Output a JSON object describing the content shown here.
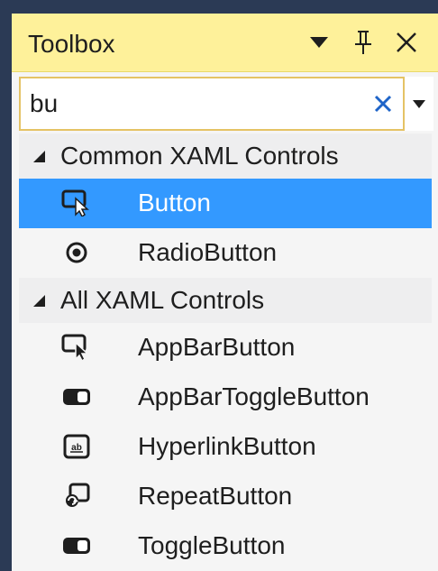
{
  "panel": {
    "title": "Toolbox",
    "buttons": {
      "dropdown_icon": "triangle-down-icon",
      "pin_icon": "pin-icon",
      "close_icon": "close-icon"
    }
  },
  "search": {
    "value": "bu",
    "clear_icon": "clear-x-icon",
    "dropdown_icon": "dropdown-arrow-icon"
  },
  "groups": [
    {
      "label": "Common XAML Controls",
      "expanded": true,
      "items": [
        {
          "label": "Button",
          "icon": "button-control-icon",
          "selected": true
        },
        {
          "label": "RadioButton",
          "icon": "radio-button-icon",
          "selected": false
        }
      ]
    },
    {
      "label": "All XAML Controls",
      "expanded": true,
      "items": [
        {
          "label": "AppBarButton",
          "icon": "button-control-icon",
          "selected": false
        },
        {
          "label": "AppBarToggleButton",
          "icon": "toggle-button-icon",
          "selected": false
        },
        {
          "label": "HyperlinkButton",
          "icon": "hyperlink-button-icon",
          "selected": false
        },
        {
          "label": "RepeatButton",
          "icon": "repeat-button-icon",
          "selected": false
        },
        {
          "label": "ToggleButton",
          "icon": "toggle-button-icon",
          "selected": false
        }
      ]
    }
  ],
  "colors": {
    "title_bar": "#fef19a",
    "selection": "#3399ff",
    "clear_x": "#1e64c8",
    "background": "#f5f5f5"
  }
}
